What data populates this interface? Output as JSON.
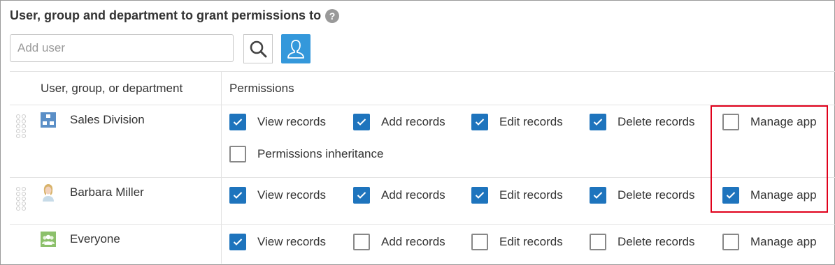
{
  "title": "User, group and department to grant permissions to",
  "help_icon_glyph": "?",
  "search": {
    "placeholder": "Add user",
    "value": ""
  },
  "icons": {
    "search": "search-icon",
    "user_select": "user-icon",
    "help": "help-icon",
    "reorder": "drag-handle-icon"
  },
  "colors": {
    "accent": "#3498db",
    "checkbox_checked": "#1e74bd",
    "highlight_box": "#e0001a"
  },
  "table": {
    "col_entity": "User, group, or department",
    "col_permissions": "Permissions",
    "rows": [
      {
        "name": "Sales Division",
        "type": "department",
        "perms": [
          {
            "label": "View records",
            "checked": true
          },
          {
            "label": "Add records",
            "checked": true
          },
          {
            "label": "Edit records",
            "checked": true
          },
          {
            "label": "Delete records",
            "checked": true
          },
          {
            "label": "Manage app",
            "checked": false
          },
          {
            "label": "Permissions inheritance",
            "checked": false
          }
        ]
      },
      {
        "name": "Barbara Miller",
        "type": "user",
        "perms": [
          {
            "label": "View records",
            "checked": true
          },
          {
            "label": "Add records",
            "checked": true
          },
          {
            "label": "Edit records",
            "checked": true
          },
          {
            "label": "Delete records",
            "checked": true
          },
          {
            "label": "Manage app",
            "checked": true
          }
        ]
      },
      {
        "name": "Everyone",
        "type": "group",
        "perms": [
          {
            "label": "View records",
            "checked": true
          },
          {
            "label": "Add records",
            "checked": false
          },
          {
            "label": "Edit records",
            "checked": false
          },
          {
            "label": "Delete records",
            "checked": false
          },
          {
            "label": "Manage app",
            "checked": false
          }
        ]
      }
    ]
  }
}
